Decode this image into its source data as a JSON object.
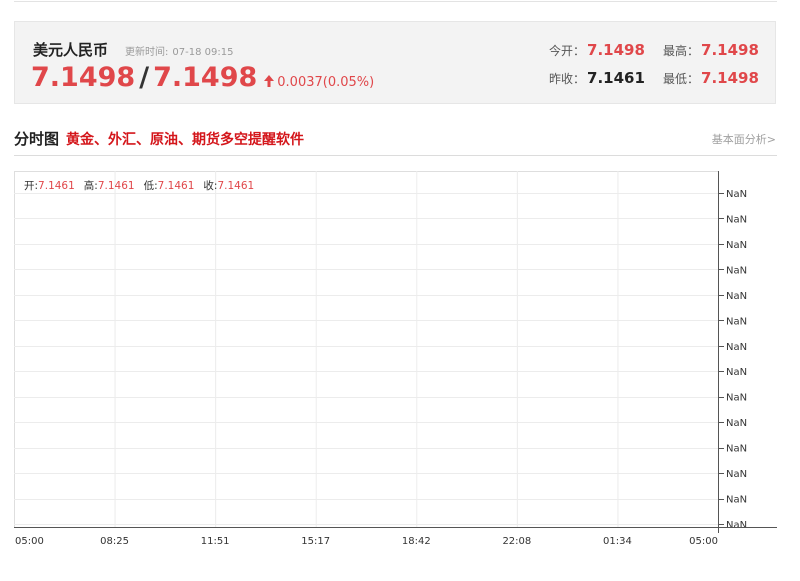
{
  "quote": {
    "name": "美元人民币",
    "updated_label": "更新时间:",
    "updated_time": "07-18 09:15",
    "price_bid": "7.1498",
    "slash": "/",
    "price_ask": "7.1498",
    "change": "0.0037(0.05%)",
    "direction": "up",
    "stats": {
      "open_label": "今开：",
      "open_value": "7.1498",
      "high_label": "最高：",
      "high_value": "7.1498",
      "prev_close_label": "昨收：",
      "prev_close_value": "7.1461",
      "low_label": "最低：",
      "low_value": "7.1498"
    }
  },
  "section": {
    "title": "分时图",
    "promo": "黄金、外汇、原油、期货多空提醒软件",
    "link": "基本面分析>"
  },
  "ohlc": {
    "open_label": "开:",
    "open_value": "7.1461",
    "high_label": "高:",
    "high_value": "7.1461",
    "low_label": "低:",
    "low_value": "7.1461",
    "close_label": "收:",
    "close_value": "7.1461"
  },
  "chart_data": {
    "type": "line",
    "x_ticks": [
      "05:00",
      "08:25",
      "11:51",
      "15:17",
      "18:42",
      "22:08",
      "01:34",
      "05:00"
    ],
    "y_ticks": [
      "NaN",
      "NaN",
      "NaN",
      "NaN",
      "NaN",
      "NaN",
      "NaN",
      "NaN",
      "NaN",
      "NaN",
      "NaN",
      "NaN",
      "NaN",
      "NaN"
    ],
    "series": [],
    "grid": true,
    "colors": {
      "grid": "#ececec",
      "axis": "#555555",
      "up": "#e0474a"
    }
  }
}
